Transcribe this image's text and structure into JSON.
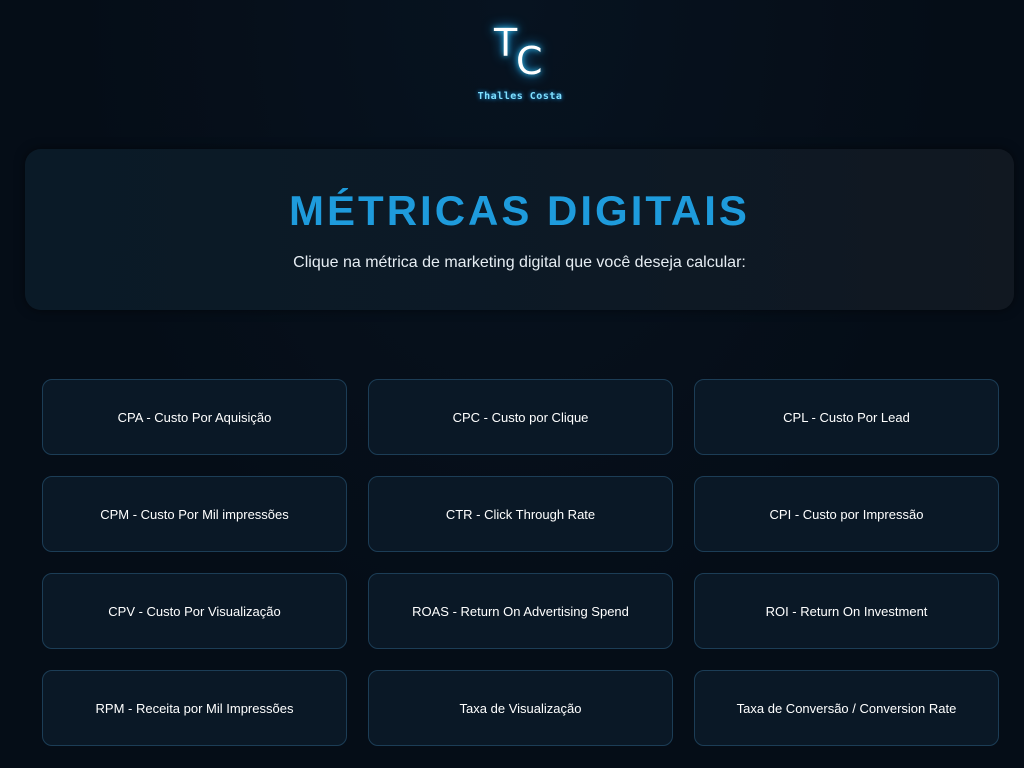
{
  "logo": {
    "letter_t": "T",
    "letter_c": "C",
    "name": "Thalles Costa"
  },
  "hero": {
    "title": "MÉTRICAS DIGITAIS",
    "subtitle": "Clique na métrica de marketing digital que você deseja calcular:"
  },
  "metrics": [
    {
      "label": "CPA - Custo Por Aquisição"
    },
    {
      "label": "CPC - Custo por Clique"
    },
    {
      "label": "CPL - Custo Por Lead"
    },
    {
      "label": "CPM - Custo Por Mil impressões"
    },
    {
      "label": "CTR - Click Through Rate"
    },
    {
      "label": "CPI - Custo por Impressão"
    },
    {
      "label": "CPV - Custo Por Visualização"
    },
    {
      "label": "ROAS - Return On Advertising Spend"
    },
    {
      "label": "ROI - Return On Investment"
    },
    {
      "label": "RPM - Receita por Mil Impressões"
    },
    {
      "label": "Taxa de Visualização"
    },
    {
      "label": "Taxa de Conversão / Conversion Rate"
    }
  ],
  "colors": {
    "background": "#050d17",
    "accent": "#1e9bdc",
    "button_bg": "#0a1826",
    "button_border": "#1c3d56"
  }
}
